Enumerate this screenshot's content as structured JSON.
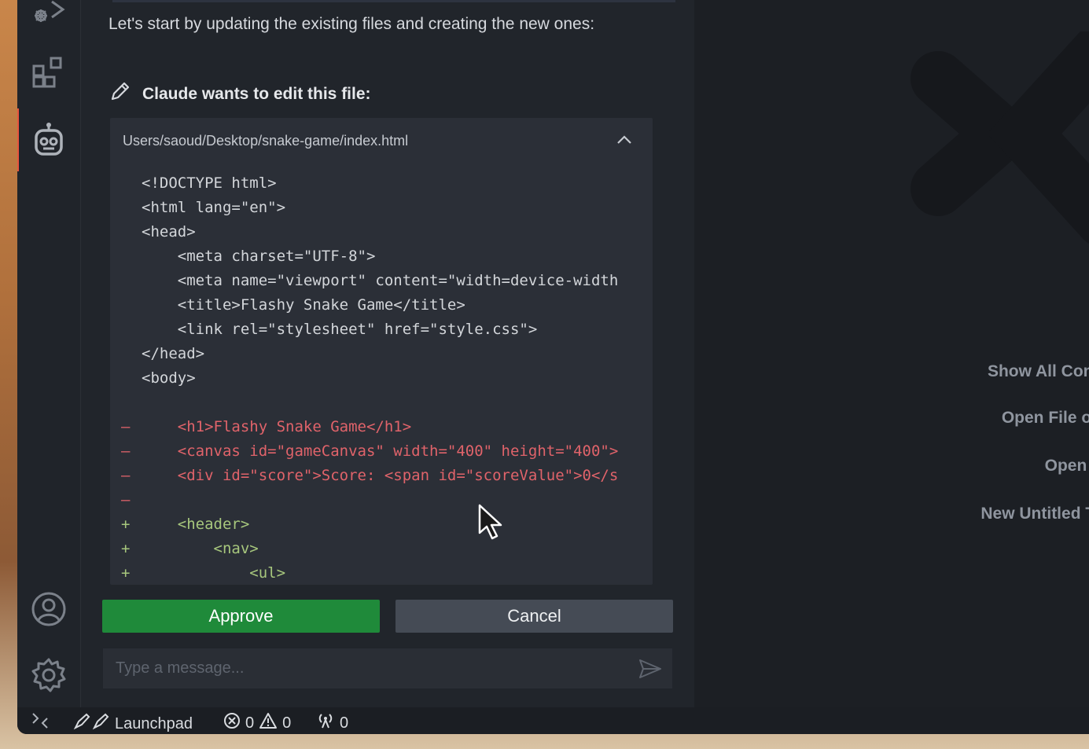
{
  "panel": {
    "intro_text": "Let's start by updating the existing files and creating the new ones:",
    "edit_title": "Claude wants to edit this file:",
    "file_path": "Users/saoud/Desktop/snake-game/index.html",
    "diff_lines": [
      {
        "type": "ctx",
        "marker": "",
        "text": "<!DOCTYPE html>"
      },
      {
        "type": "ctx",
        "marker": "",
        "text": "<html lang=\"en\">"
      },
      {
        "type": "ctx",
        "marker": "",
        "text": "<head>"
      },
      {
        "type": "ctx",
        "marker": "",
        "text": "    <meta charset=\"UTF-8\">"
      },
      {
        "type": "ctx",
        "marker": "",
        "text": "    <meta name=\"viewport\" content=\"width=device-width"
      },
      {
        "type": "ctx",
        "marker": "",
        "text": "    <title>Flashy Snake Game</title>"
      },
      {
        "type": "ctx",
        "marker": "",
        "text": "    <link rel=\"stylesheet\" href=\"style.css\">"
      },
      {
        "type": "ctx",
        "marker": "",
        "text": "</head>"
      },
      {
        "type": "ctx",
        "marker": "",
        "text": "<body>"
      },
      {
        "type": "ctx",
        "marker": "",
        "text": ""
      },
      {
        "type": "del",
        "marker": "–",
        "text": "    <h1>Flashy Snake Game</h1>"
      },
      {
        "type": "del",
        "marker": "–",
        "text": "    <canvas id=\"gameCanvas\" width=\"400\" height=\"400\">"
      },
      {
        "type": "del",
        "marker": "–",
        "text": "    <div id=\"score\">Score: <span id=\"scoreValue\">0</s"
      },
      {
        "type": "del",
        "marker": "–",
        "text": ""
      },
      {
        "type": "add",
        "marker": "+",
        "text": "    <header>"
      },
      {
        "type": "add",
        "marker": "+",
        "text": "        <nav>"
      },
      {
        "type": "add",
        "marker": "+",
        "text": "            <ul>"
      }
    ],
    "approve_label": "Approve",
    "cancel_label": "Cancel",
    "message_placeholder": "Type a message..."
  },
  "editor": {
    "shortcuts": [
      "Show All Comm",
      "Open File or F",
      "Open Re",
      "New Untitled Tex"
    ]
  },
  "statusbar": {
    "launchpad_label": "Launchpad",
    "errors": "0",
    "warnings": "0",
    "ports": "0"
  },
  "colors": {
    "approve": "#1f8a3a",
    "cancel": "#454b55",
    "deleted_line": "#e0636a",
    "added_line": "#a7c77d",
    "active_indicator": "#e8553f"
  }
}
